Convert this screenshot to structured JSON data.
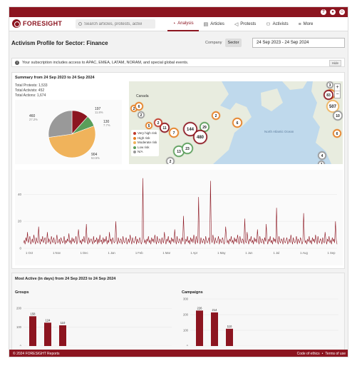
{
  "app": {
    "brand": "FORESIGHT"
  },
  "search": {
    "placeholder": "Search articles, protests, activi"
  },
  "nav": [
    {
      "label": "Analysis",
      "icon": "chart-icon"
    },
    {
      "label": "Articles",
      "icon": "document-icon"
    },
    {
      "label": "Protests",
      "icon": "megaphone-icon"
    },
    {
      "label": "Activists",
      "icon": "people-icon"
    },
    {
      "label": "More",
      "icon": "menu-icon"
    }
  ],
  "page": {
    "title": "Activism Profile for Sector: Finance",
    "toggle": {
      "left": "Company",
      "right": "Sector"
    },
    "date_range": "24 Sep 2023 - 24 Sep 2024"
  },
  "banner": {
    "text": "Your subscription includes access to APAC, EMEA, LATAM, NORAM, and special global events.",
    "button": "Hide"
  },
  "summary": {
    "title": "Summary from 24 Sep 2023 to 24 Sep 2024",
    "total_protests": "Total Protests: 1,533",
    "total_activists": "Total Activists: 452",
    "total_actions": "Total Actions: 1,674"
  },
  "map": {
    "legend": [
      {
        "label": "Very high risk",
        "color": "#c0392b"
      },
      {
        "label": "High risk",
        "color": "#e67e22"
      },
      {
        "label": "Moderate risk",
        "color": "#f0b35b"
      },
      {
        "label": "Low risk",
        "color": "#5a9e5a"
      },
      {
        "label": "N/A",
        "color": "#999999"
      }
    ],
    "labels": {
      "canada": "Canada",
      "sea": "North Atlantic Ocean"
    },
    "clusters": [
      "3",
      "2",
      "6",
      "2",
      "144",
      "29",
      "6",
      "11",
      "7",
      "480",
      "13",
      "23",
      "2",
      "2",
      "2",
      "5",
      "3",
      "83",
      "507",
      "10",
      "6",
      "4",
      "2"
    ]
  },
  "chart_data": [
    {
      "type": "pie",
      "slices": [
        {
          "label": "197",
          "pct": "11.8%",
          "value": 197,
          "color": "#8c1520"
        },
        {
          "label": "130",
          "pct": "7.7%",
          "value": 130,
          "color": "#5a9e5a"
        },
        {
          "label": "904",
          "pct": "53.5%",
          "value": 904,
          "color": "#f0b35b"
        },
        {
          "label": "460",
          "pct": "27.2%",
          "value": 460,
          "color": "#999999"
        }
      ]
    },
    {
      "type": "line",
      "ylim": [
        0,
        55
      ],
      "yticks": [
        "0",
        "20",
        "40"
      ],
      "xticks": [
        "1 Oct",
        "1 Nov",
        "1 Dec",
        "1 Jan",
        "1 Feb",
        "1 Mar",
        "1 Apr",
        "1 May",
        "1 Jun",
        "1 Jul",
        "1 Aug",
        "1 Sep"
      ],
      "values": [
        4,
        6,
        3,
        8,
        5,
        12,
        4,
        6,
        9,
        3,
        5,
        7,
        4,
        10,
        6,
        3,
        8,
        5,
        4,
        16,
        6,
        3,
        7,
        5,
        9,
        4,
        6,
        8,
        3,
        5,
        12,
        4,
        7,
        5,
        3,
        9,
        6,
        4,
        8,
        5,
        3,
        6,
        10,
        4,
        5,
        7,
        3,
        8,
        6,
        4,
        5,
        9,
        3,
        6,
        4,
        7,
        5,
        11,
        4,
        6,
        3,
        8,
        5,
        7,
        4,
        6,
        9,
        3,
        5,
        14,
        8,
        4,
        6,
        3,
        7,
        5,
        9,
        4,
        6,
        18,
        5,
        3,
        8,
        4,
        6,
        7,
        5,
        3,
        9,
        4,
        6,
        5,
        8,
        3,
        7,
        4,
        10,
        5,
        6,
        3,
        8,
        4,
        7,
        5,
        9,
        3,
        6,
        4,
        12,
        5,
        7,
        3,
        8,
        6,
        4,
        5,
        20,
        6,
        3,
        8,
        5,
        4,
        7,
        6,
        3,
        9,
        5,
        4,
        6,
        8,
        3,
        5,
        7,
        4,
        10,
        6,
        3,
        8,
        5,
        4,
        6,
        9,
        3,
        7,
        5,
        4,
        8,
        6,
        3,
        5,
        52,
        8,
        4,
        6,
        3,
        7,
        5,
        9,
        4,
        6,
        3,
        8,
        5,
        7,
        4,
        10,
        6,
        3,
        9,
        5,
        4,
        7,
        6,
        3,
        8,
        5,
        4,
        12,
        6,
        3,
        7,
        5,
        9,
        4,
        6,
        3,
        8,
        5,
        7,
        4,
        14,
        6,
        3,
        9,
        5,
        4,
        7,
        6,
        3,
        8,
        5,
        24,
        6,
        3,
        7,
        5,
        9,
        4,
        6,
        3,
        8,
        5,
        7,
        4,
        10,
        6,
        3,
        9,
        5,
        4,
        38,
        6,
        3,
        8,
        5,
        4,
        7,
        6,
        3,
        9,
        5,
        4,
        6,
        8,
        3,
        50,
        7,
        4,
        10,
        6,
        3,
        8,
        5,
        4,
        6,
        9,
        3,
        7,
        5,
        4,
        8,
        6,
        3,
        5,
        16,
        8,
        4,
        6,
        3,
        7,
        5,
        9,
        4,
        6,
        3,
        8,
        5,
        7,
        4,
        10,
        6,
        3,
        9,
        5,
        4,
        7,
        6,
        3,
        22,
        5,
        4,
        12,
        6,
        3,
        7,
        5,
        9,
        4,
        6,
        3,
        8,
        5,
        7,
        4,
        14,
        6,
        3,
        9,
        5,
        4,
        7,
        6,
        3,
        8,
        5,
        18,
        6,
        3,
        7,
        5,
        9,
        4,
        6,
        3,
        8,
        5,
        7,
        4,
        30,
        6,
        3,
        9,
        5,
        4,
        7,
        6,
        3,
        8,
        5,
        4,
        6,
        8,
        3,
        5,
        7,
        4,
        10,
        6,
        3,
        8,
        5,
        4,
        6,
        9,
        3,
        7,
        5,
        4,
        8,
        6,
        3,
        5,
        26,
        8,
        4,
        6,
        3,
        7,
        5,
        9,
        4,
        6,
        3,
        8,
        5,
        7,
        4,
        10,
        6,
        3,
        9,
        5,
        4,
        7,
        6,
        3,
        8,
        5,
        4,
        12,
        6,
        3,
        7,
        5,
        9,
        4,
        6,
        3,
        8,
        5,
        7,
        4,
        20,
        6,
        3
      ]
    },
    {
      "type": "bar",
      "title": "Groups",
      "yticks": [
        "0",
        "100",
        "200"
      ],
      "ylim": [
        0,
        250
      ],
      "values": [
        158,
        124,
        110
      ],
      "labels": [
        "158",
        "124",
        "110"
      ]
    },
    {
      "type": "bar",
      "title": "Campaigns",
      "yticks": [
        "0",
        "100",
        "200",
        "300"
      ],
      "ylim": [
        0,
        300
      ],
      "values": [
        226,
        214,
        110
      ],
      "labels": [
        "226",
        "214",
        "110"
      ]
    }
  ],
  "most_active": {
    "title": "Most Active (in days) from 24 Sep 2023 to 24 Sep 2024"
  },
  "footer": {
    "copyright": "© 2024 FORESIGHT Reports",
    "links": [
      "Code of ethics",
      "•",
      "Terms of use"
    ]
  },
  "colors": {
    "brand": "#8c1520"
  }
}
